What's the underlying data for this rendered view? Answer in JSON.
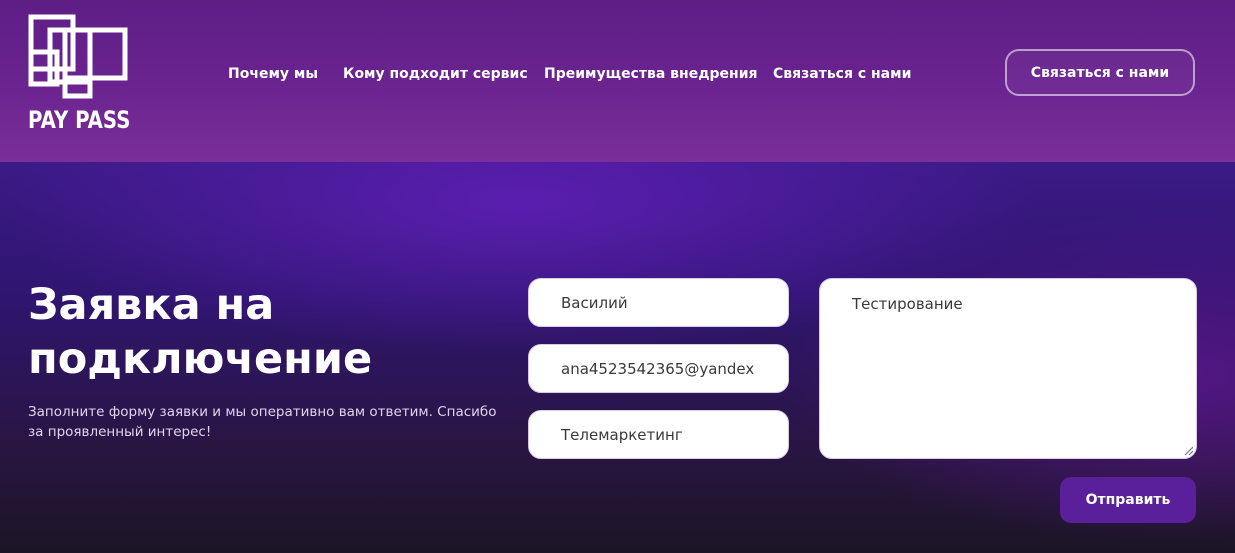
{
  "header": {
    "logo_text": "PAY PASS",
    "nav": [
      "Почему мы",
      "Кому подходит сервис",
      "Преимущества внедрения",
      "Связаться с нами"
    ],
    "cta_label": "Связаться с нами"
  },
  "main": {
    "title_line1": "Заявка на",
    "title_line2": "подключение",
    "subtitle": "Заполните форму заявки и мы оперативно вам ответим. Спасибо за проявленный интерес!"
  },
  "form": {
    "name_value": "Василий",
    "email_value": "ana4523542365@yandex",
    "company_value": "Телемаркетинг",
    "message_value": "Тестирование",
    "submit_label": "Отправить"
  },
  "colors": {
    "header_bg": "#6b2490",
    "hero_bg": "#2f1570",
    "submit_bg": "#5a1f9a"
  }
}
